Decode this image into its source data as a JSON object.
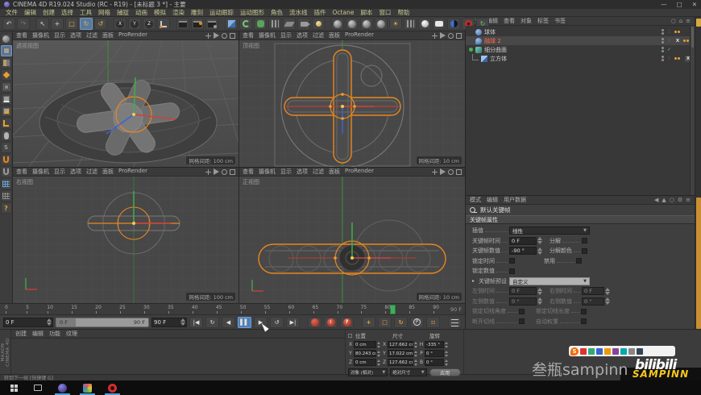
{
  "window": {
    "title": "CINEMA 4D R19.024 Studio (RC - R19) - [未标题 3 *] - 主要",
    "minimize": "—",
    "maximize": "□",
    "close": "✕"
  },
  "menubar": {
    "items": [
      "文件",
      "编辑",
      "创建",
      "选择",
      "工具",
      "网格",
      "捕捉",
      "动画",
      "模拟",
      "渲染",
      "雕刻",
      "运动跟踪",
      "运动图形",
      "角色",
      "流水线",
      "插件",
      "Octane",
      "脚本",
      "窗口",
      "帮助"
    ]
  },
  "viewport_menu": [
    "查看",
    "摄像机",
    "显示",
    "选项",
    "过滤",
    "面板",
    "ProRender"
  ],
  "viewports": {
    "perspective": {
      "label": "透视视图",
      "grid": "网格间距: 100 cm"
    },
    "top": {
      "label": "顶视图",
      "grid": "网格间距: 10 cm"
    },
    "right": {
      "label": "右视图",
      "grid": "网格间距: 100 cm"
    },
    "front": {
      "label": "正视图",
      "grid": "网格间距: 10 cm"
    }
  },
  "object_manager": {
    "menu": [
      "文件",
      "编辑",
      "查看",
      "对象",
      "标签",
      "书签"
    ],
    "objects": [
      {
        "name": "球体"
      },
      {
        "name": "融球 2"
      },
      {
        "name": "细分曲面"
      },
      {
        "name": "立方体"
      }
    ]
  },
  "attributes": {
    "menu": [
      "模式",
      "编辑",
      "用户数据"
    ],
    "title": "默认关键帧",
    "section": "关键帧属性",
    "interp_label": "插值",
    "interp_value": "线性",
    "key_time_label": "关键帧时间",
    "key_time_value": "0 F",
    "break_label": "分解",
    "key_value_label": "关键帧数值",
    "key_value_value": "-90 °",
    "break_color_label": "分解颜色",
    "lock_time_label": "锁定时间",
    "mute_label": "禁用",
    "lock_value_label": "锁定数值",
    "preset_label": "关键帧预设",
    "preset_value": "自定义",
    "left_time_label": "左侧时间",
    "left_time_value": "0 F",
    "right_time_label": "右侧时间",
    "right_time_value": "0 F",
    "left_value_label": "左侧数值",
    "left_value_value": "0 °",
    "right_value_label": "右侧数值",
    "right_value_value": "0 °",
    "lock_tangent_angle_label": "锁定切线角度",
    "lock_tangent_length_label": "锁定切线长度",
    "break_tangent_label": "断开切线",
    "auto_weight_label": "自动权重"
  },
  "timeline": {
    "ticks": [
      "0",
      "5",
      "10",
      "15",
      "20",
      "25",
      "30",
      "35",
      "40",
      "45",
      "50",
      "55",
      "60",
      "65",
      "70",
      "75",
      "80",
      "85",
      "90"
    ],
    "current_frame": 80,
    "end_label": "90 F"
  },
  "transport": {
    "start_value": "0 F",
    "end_value": "90 F",
    "range_start": "0 F",
    "range_end": "90 F"
  },
  "materials_menu": [
    "创建",
    "编辑",
    "功能",
    "纹理"
  ],
  "coordinates": {
    "headers": [
      "位置",
      "尺寸",
      "旋转"
    ],
    "px_label": "X",
    "py_label": "Y",
    "pz_label": "Z",
    "px": "0 cm",
    "py": "80.243 cm",
    "pz": "0 cm",
    "sx": "127.662 cm",
    "sy": "17.022 cm",
    "sz": "127.662 cm",
    "rh_label": "H",
    "rp_label": "P",
    "rb_label": "B",
    "rh": "-335 °",
    "rp": "0 °",
    "rb": "0 °",
    "mode": "对象 (相对)",
    "size_mode": "绝对尺寸",
    "apply": "应用"
  },
  "brand": {
    "line1": "MAXON",
    "line2": "CINEMA 4D"
  },
  "statusbar": {
    "text": "转到下一帧 [快捷键 G]"
  },
  "watermark": {
    "sogou": "S",
    "name": "叁瓶sampinn",
    "bili": "bilibili",
    "badge": "SAMPINN"
  },
  "icons": {
    "undo": "↶",
    "redo": "↷",
    "cursor": "↖",
    "move": "+",
    "scale": "□",
    "rotate": "↻",
    "last_tool": "↺",
    "axis_x": "X",
    "axis_y": "Y",
    "axis_z": "Z",
    "go_start": "|◀",
    "play_backward": "◀",
    "pause": "▌▌",
    "play": "▶",
    "refresh": "↻",
    "loop": "↺",
    "go_end": "▶|",
    "param": "P",
    "pla": "::",
    "preset_arrow": "▸",
    "dropdown": "▼",
    "check": "✓",
    "dots2": ":",
    "search": "○",
    "home": "⌂",
    "gear": "⚙",
    "list": "≡",
    "tri_left": "◀",
    "tri_up": "▲",
    "sun": "☀",
    "question": "?",
    "s_mode": "S",
    "x_tag": "X",
    "slash": "⟍"
  }
}
